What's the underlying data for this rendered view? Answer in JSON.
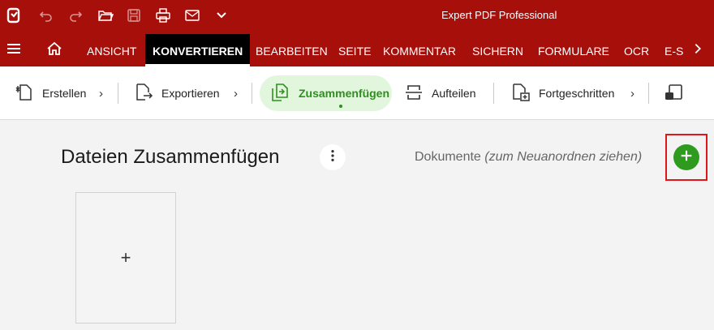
{
  "titlebar": {
    "title": "Expert PDF Professional"
  },
  "menu": {
    "tabs": [
      {
        "label": "ANSICHT"
      },
      {
        "label": "KONVERTIEREN"
      },
      {
        "label": "BEARBEITEN"
      },
      {
        "label": "SEITE"
      },
      {
        "label": "KOMMENTAR"
      },
      {
        "label": "SICHERN"
      },
      {
        "label": "FORMULARE"
      },
      {
        "label": "OCR"
      },
      {
        "label": "E-S"
      }
    ],
    "active_tab": "KONVERTIEREN"
  },
  "ribbon": {
    "items": [
      {
        "label": "Erstellen",
        "icon": "create-icon"
      },
      {
        "label": "Exportieren",
        "icon": "export-icon"
      },
      {
        "label": "Zusammenfügen",
        "icon": "merge-icon",
        "active": true
      },
      {
        "label": "Aufteilen",
        "icon": "split-icon"
      },
      {
        "label": "Fortgeschritten",
        "icon": "advanced-icon"
      }
    ]
  },
  "main": {
    "title": "Dateien Zusammenfügen",
    "documents_label": "Dokumente",
    "documents_hint": "(zum Neuanordnen ziehen)",
    "add_symbol": "+"
  },
  "colors": {
    "brand_red": "#a70f0a",
    "accent_green": "#2e9b1f",
    "highlight_frame": "#e0161a"
  }
}
